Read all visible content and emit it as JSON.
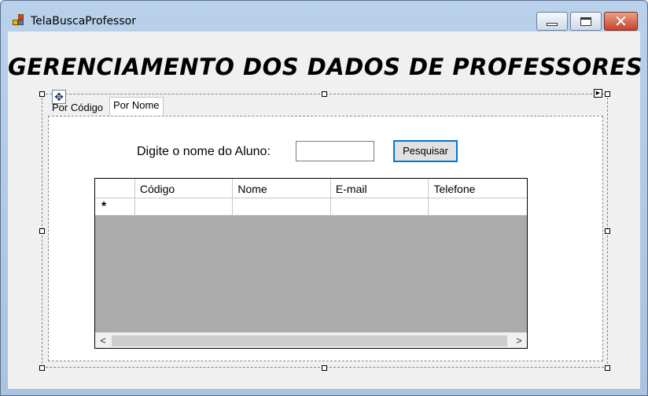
{
  "window": {
    "title": "TelaBuscaProfessor"
  },
  "form": {
    "heading": "GERENCIAMENTO DOS DADOS DE PROFESSORES"
  },
  "tabs": [
    {
      "label": "Por Código",
      "active": false
    },
    {
      "label": "Por Nome",
      "active": true
    }
  ],
  "search": {
    "label": "Digite o nome do Aluno:",
    "value": "",
    "button_label": "Pesquisar"
  },
  "grid": {
    "columns": [
      "Código",
      "Nome",
      "E-mail",
      "Telefone"
    ],
    "new_row_marker": "*",
    "scroll_left": "<",
    "scroll_right": ">"
  },
  "icons": {
    "app": "app-window-icon",
    "move": "move-handle-icon",
    "smart_tag": "smart-tag-arrow-icon"
  },
  "colors": {
    "accent": "#0078d7",
    "grid_background": "#ababab",
    "client_background": "#f0f0f0"
  }
}
